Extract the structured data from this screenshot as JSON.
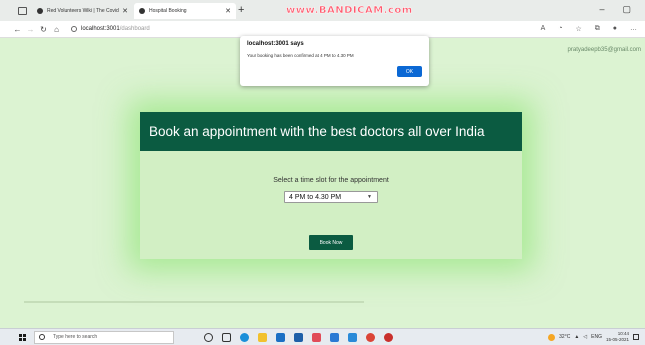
{
  "browser": {
    "tabs": [
      {
        "title": "Red Volunteers Wiki | The Covid",
        "active": false
      },
      {
        "title": "Hospital Booking",
        "active": true
      }
    ],
    "recording_watermark": "www.BANDICAM.com",
    "window_controls": {
      "minimize": "–",
      "restore": "▢"
    },
    "address": {
      "host": "localhost:3001",
      "path": "/dashboard"
    }
  },
  "page": {
    "user_email": "pratyadeepb35@gmail.com",
    "card": {
      "heading": "Book an appointment with the best doctors all over India",
      "slot_label": "Select a time slot for the appointment",
      "selected_slot": "4 PM to 4.30 PM",
      "book_button": "Book Now"
    }
  },
  "alert": {
    "title": "localhost:3001 says",
    "message": "Your booking has been confirmed at 4 PM to 4.30 PM",
    "ok_label": "OK"
  },
  "taskbar": {
    "search_placeholder": "Type here to search",
    "temperature": "32°C",
    "language": "ENG",
    "time": "10:44",
    "date": "15-05-2021"
  },
  "colors": {
    "header_green": "#0b5b41",
    "page_background": "#dcf3d2",
    "ok_blue": "#0b68d4"
  }
}
